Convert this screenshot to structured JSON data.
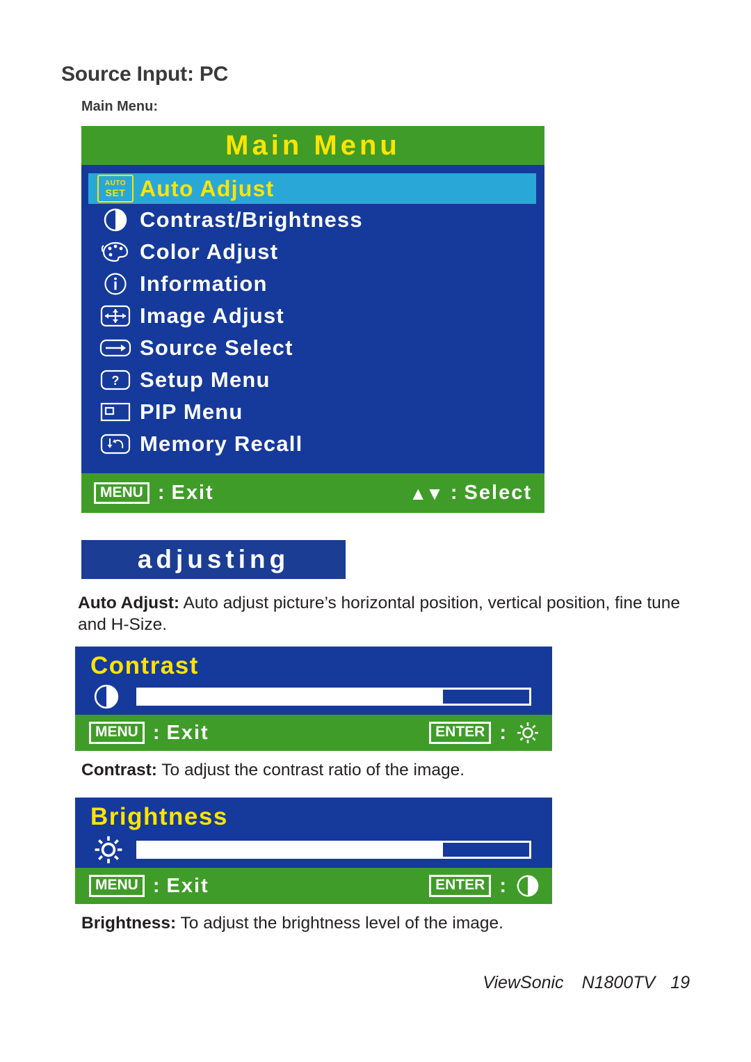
{
  "document": {
    "page_title": "Source Input: PC",
    "sub_title": "Main Menu:"
  },
  "colors": {
    "osd_green": "#3f9c28",
    "osd_blue": "#153a9b",
    "osd_highlight": "#29a8d8",
    "osd_yellow": "#ffe400",
    "osd_white": "#ffffff",
    "banner_blue": "#1b3d93",
    "text_dark": "#231f20"
  },
  "main_menu": {
    "title": "Main Menu",
    "items": [
      {
        "label": "Auto Adjust",
        "icon": "auto-set-icon",
        "selected": true
      },
      {
        "label": "Contrast/Brightness",
        "icon": "contrast-half-circle-icon",
        "selected": false
      },
      {
        "label": "Color Adjust",
        "icon": "color-palette-icon",
        "selected": false
      },
      {
        "label": "Information",
        "icon": "information-circle-icon",
        "selected": false
      },
      {
        "label": "Image Adjust",
        "icon": "image-adjust-arrows-icon",
        "selected": false
      },
      {
        "label": "Source Select",
        "icon": "source-arrow-icon",
        "selected": false
      },
      {
        "label": "Setup Menu",
        "icon": "question-mark-icon",
        "selected": false
      },
      {
        "label": "PIP Menu",
        "icon": "pip-rectangle-icon",
        "selected": false
      },
      {
        "label": "Memory Recall",
        "icon": "memory-recall-icon",
        "selected": false
      }
    ],
    "auto_set_icon": {
      "line1": "AUTO",
      "line2": "SET"
    },
    "footer": {
      "menu_key": "MENU",
      "menu_separator": ":",
      "menu_action": "Exit",
      "select_arrows": "▲▼",
      "select_separator": ":",
      "select_action": "Select"
    }
  },
  "adjusting_banner": {
    "text": "adjusting"
  },
  "descriptions": {
    "auto_adjust": {
      "term": "Auto Adjust:",
      "text": " Auto adjust picture’s horizontal position, vertical position, fine tune and H-Size."
    },
    "contrast": {
      "term": "Contrast:",
      "text": " To adjust the contrast ratio of the image."
    },
    "brightness": {
      "term": "Brightness:",
      "text": " To adjust the brightness level of the image."
    }
  },
  "contrast_panel": {
    "title": "Contrast",
    "icon": "contrast-half-circle-icon",
    "slider_percent": 78,
    "footer": {
      "menu_key": "MENU",
      "menu_separator": ":",
      "menu_action": "Exit",
      "enter_key": "ENTER",
      "enter_separator": ":",
      "enter_icon": "brightness-sun-icon"
    }
  },
  "brightness_panel": {
    "title": "Brightness",
    "icon": "brightness-sun-icon",
    "slider_percent": 78,
    "footer": {
      "menu_key": "MENU",
      "menu_separator": ":",
      "menu_action": "Exit",
      "enter_key": "ENTER",
      "enter_separator": ":",
      "enter_icon": "contrast-half-circle-icon"
    }
  },
  "footer": {
    "brand": "ViewSonic",
    "model": "N1800TV",
    "page_number": "19"
  }
}
